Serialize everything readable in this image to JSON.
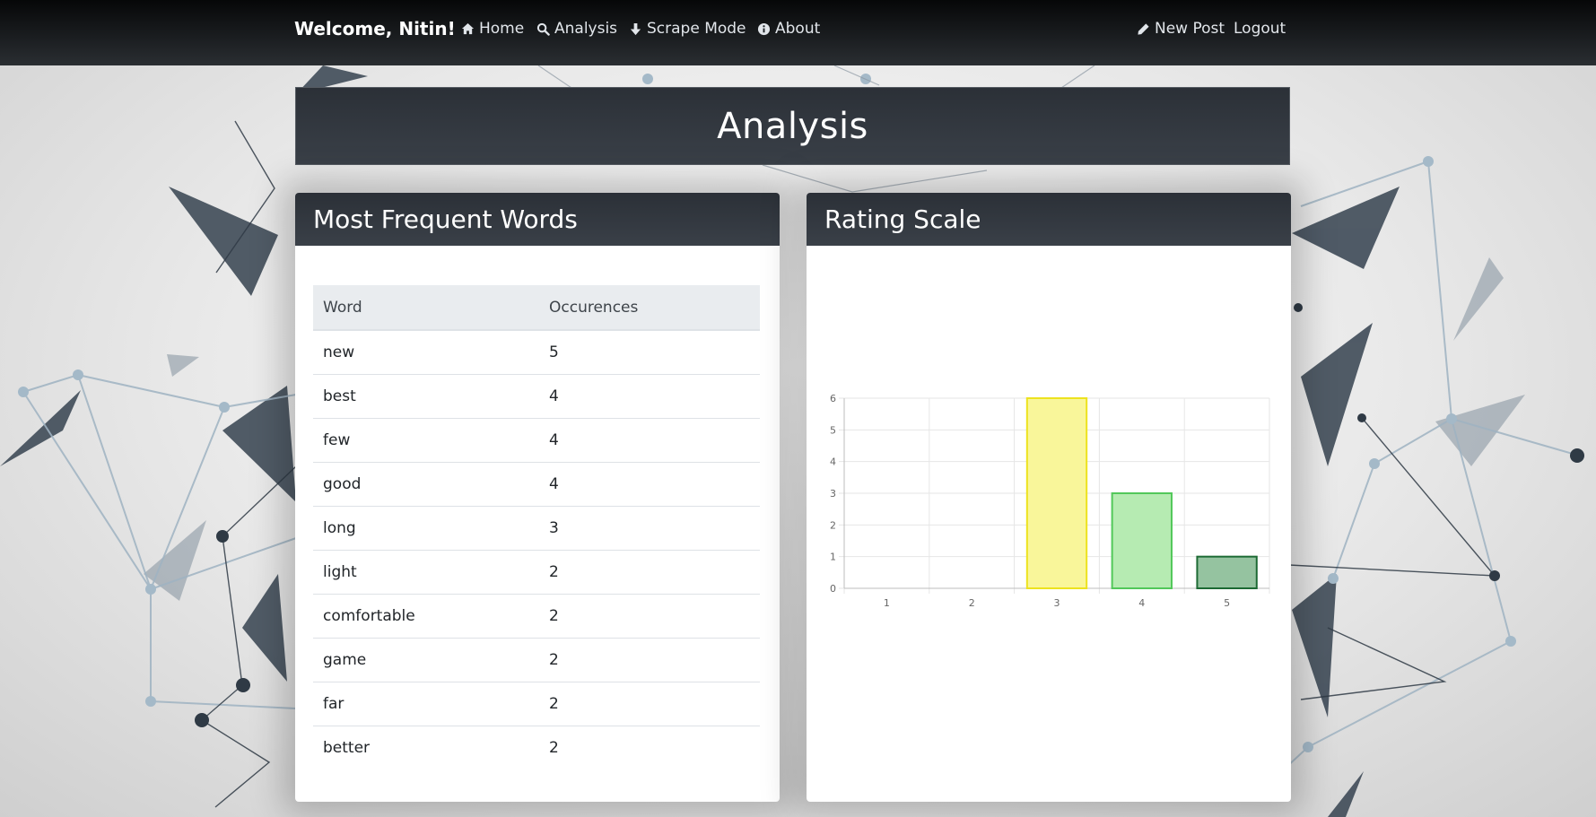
{
  "nav": {
    "brand": "Welcome, Nitin!",
    "links": [
      {
        "label": "Home",
        "icon": "home-icon"
      },
      {
        "label": "Analysis",
        "icon": "search-icon"
      },
      {
        "label": "Scrape Mode",
        "icon": "arrow-down-icon"
      },
      {
        "label": "About",
        "icon": "info-icon"
      }
    ],
    "right": [
      {
        "label": "New Post",
        "icon": "pencil-icon"
      },
      {
        "label": "Logout"
      }
    ]
  },
  "page": {
    "title": "Analysis"
  },
  "words_card": {
    "title": "Most Frequent Words",
    "columns": [
      "Word",
      "Occurences"
    ],
    "rows": [
      [
        "new",
        "5"
      ],
      [
        "best",
        "4"
      ],
      [
        "few",
        "4"
      ],
      [
        "good",
        "4"
      ],
      [
        "long",
        "3"
      ],
      [
        "light",
        "2"
      ],
      [
        "comfortable",
        "2"
      ],
      [
        "game",
        "2"
      ],
      [
        "far",
        "2"
      ],
      [
        "better",
        "2"
      ]
    ]
  },
  "rating_card": {
    "title": "Rating Scale"
  },
  "chart_data": {
    "type": "bar",
    "categories": [
      "1",
      "2",
      "3",
      "4",
      "5"
    ],
    "values": [
      0,
      0,
      6,
      3,
      1
    ],
    "ylim": [
      0,
      6
    ],
    "yticks": [
      0,
      1,
      2,
      3,
      4,
      5,
      6
    ],
    "grid": true,
    "bar_fill_colors": [
      "#fff57a",
      "#fff57a",
      "#f9f69a",
      "#b6ebb2",
      "#95c3a0"
    ],
    "bar_edge_colors": [
      "#f3e21e",
      "#f3e21e",
      "#ede21f",
      "#52c85a",
      "#1d6a34"
    ]
  },
  "colors": {
    "navbar": "#15181b",
    "header": "#343a40",
    "table_head": "#e9ecef"
  }
}
